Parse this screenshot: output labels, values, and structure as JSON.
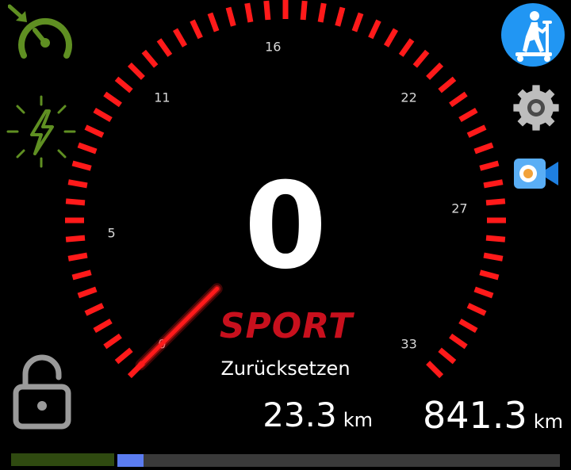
{
  "gauge": {
    "min": 0,
    "max": 33,
    "value": 0,
    "tick_labels": [
      "0",
      "5",
      "11",
      "16",
      "22",
      "27",
      "33"
    ],
    "tick_values": [
      0,
      5,
      11,
      16,
      22,
      27,
      33
    ],
    "tick_count": 55,
    "tick_color": "#ff1a1a",
    "needle_color": "#ff1a1a"
  },
  "speed": {
    "value": "0"
  },
  "mode": {
    "label": "SPORT",
    "color": "#c8101d"
  },
  "trip": {
    "reset_label": "Zurücksetzen",
    "distance": "23.3",
    "unit": "km"
  },
  "odometer": {
    "distance": "841.3",
    "unit": "km"
  },
  "icons": {
    "cruise": "cruise-control-icon",
    "charge": "charging-icon",
    "lock": "unlocked-padlock-icon",
    "mode_button": "scooter-rider-icon",
    "settings": "gear-icon",
    "camera": "video-camera-icon",
    "accent_green": "#5f8f22",
    "accent_blue": "#2196f3"
  },
  "bottom_bar": {
    "battery_color": "#2f4a10",
    "progress_color": "#5b7cf0",
    "progress_fraction": 0.06
  }
}
